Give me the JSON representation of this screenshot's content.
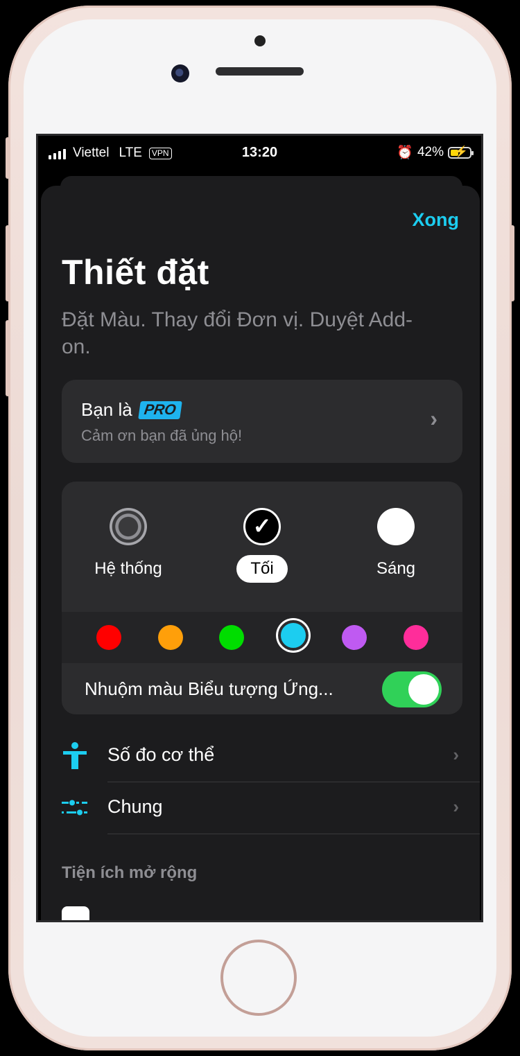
{
  "status_bar": {
    "carrier": "Viettel",
    "network": "LTE",
    "vpn": "VPN",
    "time": "13:20",
    "battery_percent": "42%",
    "battery_level": 0.42
  },
  "sheet": {
    "done_label": "Xong",
    "title": "Thiết đặt",
    "subtitle": "Đặt Màu. Thay đổi Đơn vị. Duyệt Add-on."
  },
  "pro_card": {
    "title": "Bạn là",
    "badge": "PRO",
    "subtitle": "Cảm ơn bạn đã ủng hộ!"
  },
  "theme": {
    "options": [
      {
        "label": "Hệ thống",
        "icon": "gear-icon",
        "selected": false
      },
      {
        "label": "Tối",
        "icon": "checkmark-icon",
        "selected": true
      },
      {
        "label": "Sáng",
        "icon": "light-circle-icon",
        "selected": false
      }
    ],
    "colors": [
      "#ff0000",
      "#ff9f0a",
      "#00dd00",
      "#1ccdf0",
      "#bf5af2",
      "#ff2d9a"
    ],
    "selected_color": "#1ccdf0",
    "tint_label": "Nhuộm màu Biểu tượng Ứng...",
    "tint_enabled": true
  },
  "menu": {
    "items": [
      {
        "label": "Số đo cơ thể",
        "icon": "person-icon"
      },
      {
        "label": "Chung",
        "icon": "sliders-icon"
      }
    ]
  },
  "extensions": {
    "header": "Tiện ích mở rộng"
  },
  "colors": {
    "accent": "#1ccdf0",
    "toggle_on": "#30d158",
    "sheet_bg": "#1c1c1e",
    "card_bg": "#2c2c2e"
  }
}
